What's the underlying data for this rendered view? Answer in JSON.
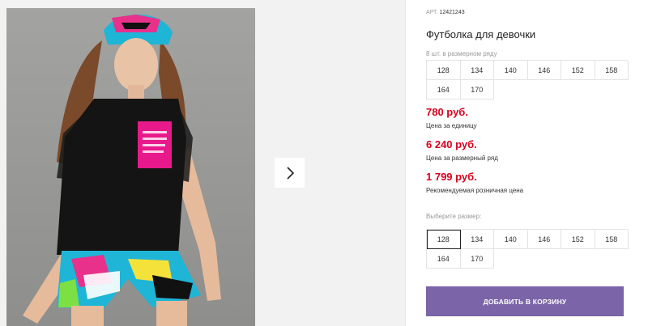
{
  "gallery": {
    "image_alt": "girl-in-black-tshirt-photo",
    "next_icon": "chevron-right-icon"
  },
  "product": {
    "sku_label": "АРТ.",
    "sku": "12421243",
    "title": "Футболка для девочки",
    "pack_label": "8 шт. в размерном ряду",
    "pack_sizes": [
      "128",
      "134",
      "140",
      "146",
      "152",
      "158",
      "164",
      "170"
    ],
    "price_unit": "780 руб.",
    "price_unit_note": "Цена за единицу",
    "price_pack": "6 240 руб.",
    "price_pack_note": "Цена за размерный ряд",
    "price_retail": "1 799 руб.",
    "price_retail_note": "Рекомендуемая розничная цена",
    "choose_size_label": "Выберите размер:",
    "choose_sizes": [
      "128",
      "134",
      "140",
      "146",
      "152",
      "158",
      "164",
      "170"
    ],
    "selected_size": "128",
    "add_to_cart": "ДОБАВИТЬ В КОРЗИНУ"
  },
  "colors": {
    "price": "#d6001c",
    "button": "#7b64a8"
  }
}
